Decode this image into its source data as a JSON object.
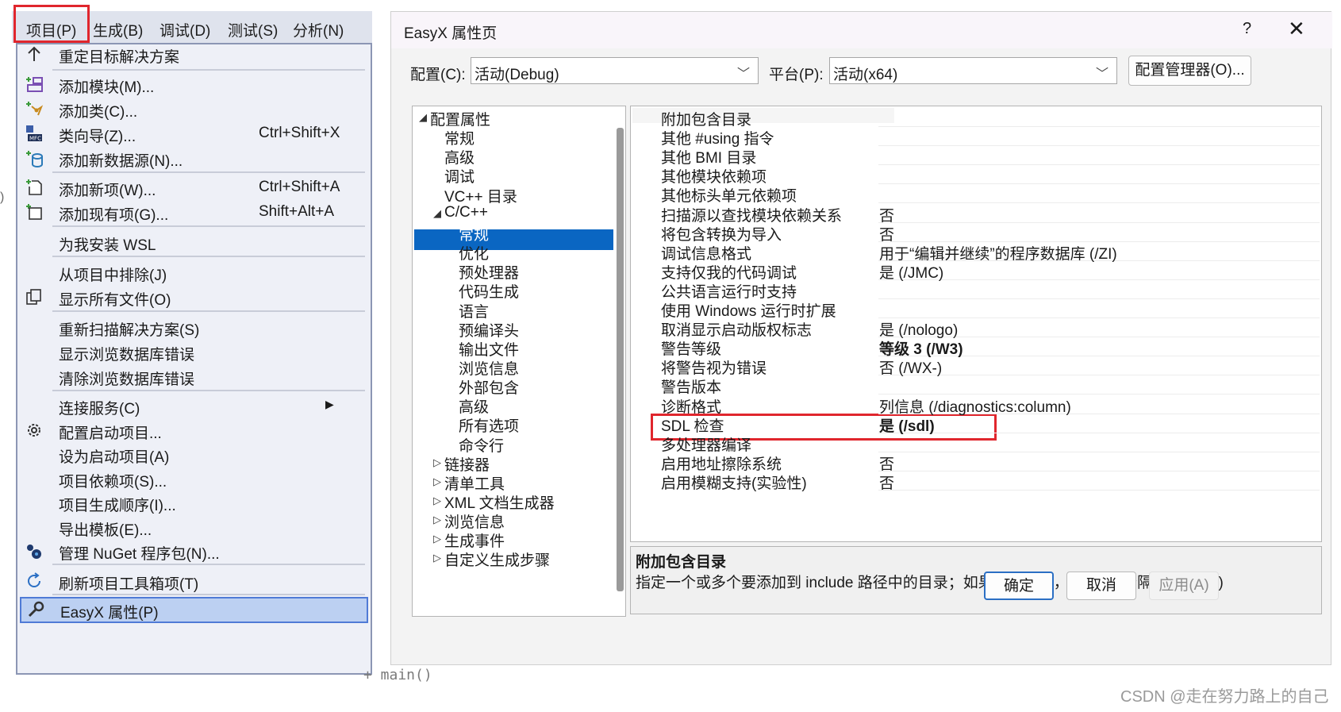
{
  "menubar": {
    "items": [
      "项目(P)",
      "生成(B)",
      "调试(D)",
      "测试(S)",
      "分析(N)"
    ]
  },
  "project_menu": {
    "items": [
      {
        "label": "重定目标解决方案",
        "icon": "arrow-up-icon"
      },
      {
        "label": "添加模块(M)...",
        "icon": "add-module-icon"
      },
      {
        "label": "添加类(C)...",
        "icon": "add-class-icon"
      },
      {
        "label": "类向导(Z)...",
        "shortcut": "Ctrl+Shift+X",
        "icon": "class-wizard-icon"
      },
      {
        "label": "添加新数据源(N)...",
        "icon": "add-datasource-icon"
      },
      {
        "label": "添加新项(W)...",
        "shortcut": "Ctrl+Shift+A",
        "icon": "add-new-item-icon"
      },
      {
        "label": "添加现有项(G)...",
        "shortcut": "Shift+Alt+A",
        "icon": "add-existing-item-icon"
      },
      {
        "label": "为我安装 WSL"
      },
      {
        "label": "从项目中排除(J)"
      },
      {
        "label": "显示所有文件(O)",
        "icon": "show-all-files-icon"
      },
      {
        "label": "重新扫描解决方案(S)"
      },
      {
        "label": "显示浏览数据库错误"
      },
      {
        "label": "清除浏览数据库错误"
      },
      {
        "label": "连接服务(C)",
        "icon": "submenu-arrow-icon"
      },
      {
        "label": "配置启动项目...",
        "icon": "gear-icon"
      },
      {
        "label": "设为启动项目(A)"
      },
      {
        "label": "项目依赖项(S)..."
      },
      {
        "label": "项目生成顺序(I)..."
      },
      {
        "label": "导出模板(E)..."
      },
      {
        "label": "管理 NuGet 程序包(N)...",
        "icon": "nuget-icon"
      },
      {
        "label": "刷新项目工具箱项(T)",
        "icon": "refresh-icon"
      },
      {
        "label": "EasyX 属性(P)",
        "icon": "wrench-icon"
      }
    ]
  },
  "dialog": {
    "title": "EasyX 属性页",
    "help": "?",
    "close": "✕",
    "config_label": "配置(C):",
    "config_value": "活动(Debug)",
    "platform_label": "平台(P):",
    "platform_value": "活动(x64)",
    "config_manager": "配置管理器(O)...",
    "tree": [
      {
        "label": "配置属性",
        "toggle": "◢"
      },
      {
        "label": "常规"
      },
      {
        "label": "高级"
      },
      {
        "label": "调试"
      },
      {
        "label": "VC++ 目录"
      },
      {
        "label": "C/C++",
        "toggle": "◢"
      },
      {
        "label": "常规",
        "selected": true
      },
      {
        "label": "优化"
      },
      {
        "label": "预处理器"
      },
      {
        "label": "代码生成"
      },
      {
        "label": "语言"
      },
      {
        "label": "预编译头"
      },
      {
        "label": "输出文件"
      },
      {
        "label": "浏览信息"
      },
      {
        "label": "外部包含"
      },
      {
        "label": "高级"
      },
      {
        "label": "所有选项"
      },
      {
        "label": "命令行"
      },
      {
        "label": "链接器",
        "toggle": "▷"
      },
      {
        "label": "清单工具",
        "toggle": "▷"
      },
      {
        "label": "XML 文档生成器",
        "toggle": "▷"
      },
      {
        "label": "浏览信息",
        "toggle": "▷"
      },
      {
        "label": "生成事件",
        "toggle": "▷"
      },
      {
        "label": "自定义生成步骤",
        "toggle": "▷"
      }
    ],
    "properties": [
      {
        "name": "附加包含目录",
        "value": ""
      },
      {
        "name": "其他 #using 指令",
        "value": ""
      },
      {
        "name": "其他 BMI 目录",
        "value": ""
      },
      {
        "name": "其他模块依赖项",
        "value": ""
      },
      {
        "name": "其他标头单元依赖项",
        "value": ""
      },
      {
        "name": "扫描源以查找模块依赖关系",
        "value": "否"
      },
      {
        "name": "将包含转换为导入",
        "value": "否"
      },
      {
        "name": "调试信息格式",
        "value": "用于“编辑并继续”的程序数据库 (/ZI)"
      },
      {
        "name": "支持仅我的代码调试",
        "value": "是 (/JMC)"
      },
      {
        "name": "公共语言运行时支持",
        "value": ""
      },
      {
        "name": "使用 Windows 运行时扩展",
        "value": ""
      },
      {
        "name": "取消显示启动版权标志",
        "value": "是 (/nologo)"
      },
      {
        "name": "警告等级",
        "value": "等级 3 (/W3)",
        "bold": true
      },
      {
        "name": "将警告视为错误",
        "value": "否 (/WX-)"
      },
      {
        "name": "警告版本",
        "value": ""
      },
      {
        "name": "诊断格式",
        "value": "列信息 (/diagnostics:column)"
      },
      {
        "name": "SDL 检查",
        "value": "是 (/sdl)",
        "bold": true
      },
      {
        "name": "多处理器编译",
        "value": ""
      },
      {
        "name": "启用地址擦除系统",
        "value": "否"
      },
      {
        "name": "启用模糊支持(实验性)",
        "value": "否"
      }
    ],
    "description": {
      "title": "附加包含目录",
      "text": "指定一个或多个要添加到 include 路径中的目录；如果指定多个，请用 \";\" 分隔。(/I[path])"
    },
    "buttons": {
      "ok": "确定",
      "cancel": "取消",
      "apply": "应用(A)"
    }
  },
  "background": {
    "code_fragment": "+ main()",
    "watermark": "CSDN @走在努力路上的自己"
  },
  "colors": {
    "highlight_box": "#e0262d",
    "tree_selection": "#0a66c2",
    "menu_bg": "#eef0f7",
    "menu_selected": "#bcd0f2"
  }
}
